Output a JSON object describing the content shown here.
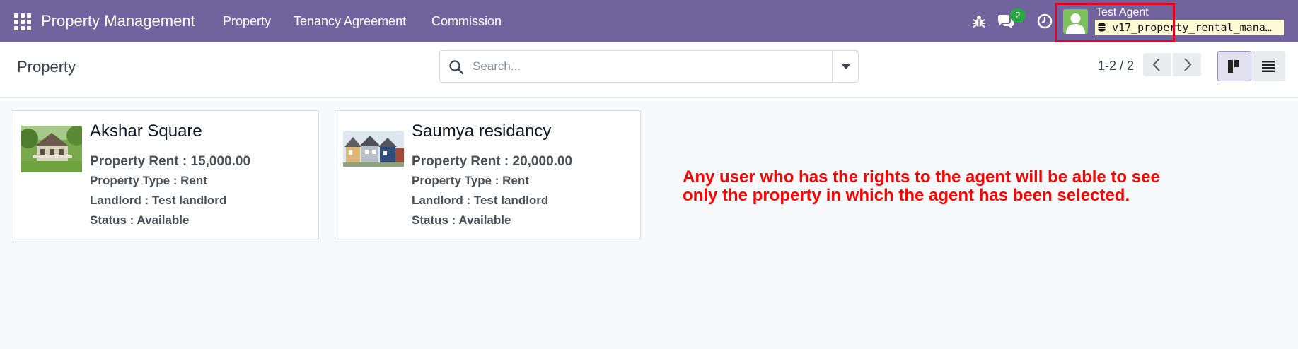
{
  "navbar": {
    "brand": "Property Management",
    "menus": [
      "Property",
      "Tenancy Agreement",
      "Commission"
    ],
    "icons": [
      "apps-grid-icon",
      "bug-icon",
      "chat-icon",
      "clock-icon"
    ],
    "messages_badge": "2",
    "user": {
      "name": "Test Agent",
      "database": "v17_property_rental_mana…"
    }
  },
  "control_panel": {
    "title": "Property",
    "search": {
      "placeholder": "Search...",
      "value": ""
    },
    "pager": "1-2 / 2",
    "views": [
      "kanban-view-icon",
      "list-view-icon"
    ],
    "active_view": "kanban"
  },
  "cards": [
    {
      "title": "Akshar Square",
      "rent": "Property Rent : 15,000.00",
      "type": "Property Type : Rent",
      "landlord": "Landlord : Test landlord",
      "status": "Status : Available"
    },
    {
      "title": "Saumya residancy",
      "rent": "Property Rent : 20,000.00",
      "type": "Property Type : Rent",
      "landlord": "Landlord : Test landlord",
      "status": "Status : Available"
    }
  ],
  "annotation": {
    "line1": "Any user who has the rights to the agent will be able to see",
    "line2": "only the property in which the agent has been selected."
  },
  "colors": {
    "navbar": "#71639e",
    "highlight_box": "#e8001c",
    "annotation": "#ff0000",
    "badge": "#28a745"
  }
}
